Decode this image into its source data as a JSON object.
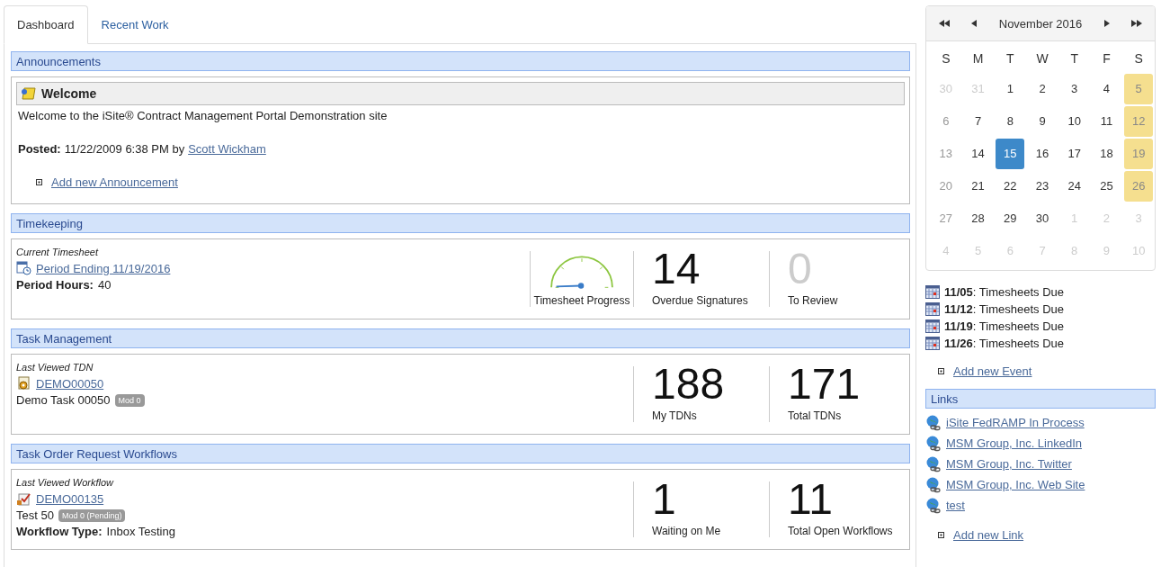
{
  "tabs": [
    {
      "label": "Dashboard",
      "selected": true
    },
    {
      "label": "Recent Work",
      "selected": false
    }
  ],
  "announcements": {
    "title": "Announcements",
    "items": [
      {
        "title": "Welcome",
        "body": "Welcome to the iSite® Contract Management Portal Demonstration site",
        "posted_label": "Posted:",
        "posted": "11/22/2009 6:38 PM by",
        "author": "Scott Wickham"
      }
    ],
    "add_link": "Add new Announcement"
  },
  "panels": [
    {
      "kind": "timesheet",
      "title": "Timekeeping",
      "caption": "Current Timesheet",
      "link": "Period Ending 11/19/2016",
      "detail_label": "Period Hours:",
      "detail": "40",
      "stats": [
        {
          "kind": "gauge",
          "label": "Timesheet Progress"
        },
        {
          "kind": "count",
          "value": "14",
          "label": "Overdue Signatures",
          "muted": false
        },
        {
          "kind": "count",
          "value": "0",
          "label": "To Review",
          "muted": true
        }
      ]
    },
    {
      "kind": "task",
      "title": "Task Management",
      "caption": "Last Viewed TDN",
      "link": "DEMO00050",
      "line": "Demo Task 00050",
      "badge": "Mod 0",
      "stats": [
        {
          "kind": "count",
          "value": "188",
          "label": "My TDNs",
          "muted": false
        },
        {
          "kind": "count",
          "value": "171",
          "label": "Total TDNs",
          "muted": false
        }
      ]
    },
    {
      "kind": "workflow",
      "title": "Task Order Request Workflows",
      "caption": "Last Viewed Workflow",
      "link": "DEMO00135",
      "line": "Test 50",
      "badge": "Mod 0 (Pending)",
      "detail_label": "Workflow Type:",
      "detail": "Inbox Testing",
      "stats": [
        {
          "kind": "count",
          "value": "1",
          "label": "Waiting on Me",
          "muted": false
        },
        {
          "kind": "count",
          "value": "11",
          "label": "Total Open Workflows",
          "muted": false
        }
      ]
    }
  ],
  "calendar": {
    "month": "November 2016",
    "weekdays": [
      "S",
      "M",
      "T",
      "W",
      "T",
      "F",
      "S"
    ],
    "days": [
      {
        "label": "30",
        "kind": "outside",
        "selected": false
      },
      {
        "label": "31",
        "kind": "outside",
        "selected": false
      },
      {
        "label": "1",
        "kind": "day",
        "selected": false
      },
      {
        "label": "2",
        "kind": "day",
        "selected": false
      },
      {
        "label": "3",
        "kind": "day",
        "selected": false
      },
      {
        "label": "4",
        "kind": "day",
        "selected": false
      },
      {
        "label": "5",
        "kind": "event",
        "selected": false
      },
      {
        "label": "6",
        "kind": "weekend",
        "selected": false
      },
      {
        "label": "7",
        "kind": "day",
        "selected": false
      },
      {
        "label": "8",
        "kind": "day",
        "selected": false
      },
      {
        "label": "9",
        "kind": "day",
        "selected": false
      },
      {
        "label": "10",
        "kind": "day",
        "selected": false
      },
      {
        "label": "11",
        "kind": "day",
        "selected": false
      },
      {
        "label": "12",
        "kind": "event",
        "selected": false
      },
      {
        "label": "13",
        "kind": "weekend",
        "selected": false
      },
      {
        "label": "14",
        "kind": "day",
        "selected": false
      },
      {
        "label": "15",
        "kind": "day",
        "selected": true
      },
      {
        "label": "16",
        "kind": "day",
        "selected": false
      },
      {
        "label": "17",
        "kind": "day",
        "selected": false
      },
      {
        "label": "18",
        "kind": "day",
        "selected": false
      },
      {
        "label": "19",
        "kind": "event",
        "selected": false
      },
      {
        "label": "20",
        "kind": "weekend",
        "selected": false
      },
      {
        "label": "21",
        "kind": "day",
        "selected": false
      },
      {
        "label": "22",
        "kind": "day",
        "selected": false
      },
      {
        "label": "23",
        "kind": "day",
        "selected": false
      },
      {
        "label": "24",
        "kind": "day",
        "selected": false
      },
      {
        "label": "25",
        "kind": "day",
        "selected": false
      },
      {
        "label": "26",
        "kind": "event",
        "selected": false
      },
      {
        "label": "27",
        "kind": "weekend",
        "selected": false
      },
      {
        "label": "28",
        "kind": "day",
        "selected": false
      },
      {
        "label": "29",
        "kind": "day",
        "selected": false
      },
      {
        "label": "30",
        "kind": "day",
        "selected": false
      },
      {
        "label": "1",
        "kind": "outside",
        "selected": false
      },
      {
        "label": "2",
        "kind": "outside",
        "selected": false
      },
      {
        "label": "3",
        "kind": "outside",
        "selected": false
      },
      {
        "label": "4",
        "kind": "outside",
        "selected": false
      },
      {
        "label": "5",
        "kind": "outside",
        "selected": false
      },
      {
        "label": "6",
        "kind": "outside",
        "selected": false
      },
      {
        "label": "7",
        "kind": "outside",
        "selected": false
      },
      {
        "label": "8",
        "kind": "outside",
        "selected": false
      },
      {
        "label": "9",
        "kind": "outside",
        "selected": false
      },
      {
        "label": "10",
        "kind": "outside",
        "selected": false
      }
    ]
  },
  "events": [
    "**11/05**: Timesheets Due",
    "**11/12**: Timesheets Due",
    "**11/19**: Timesheets Due",
    "**11/26**: Timesheets Due"
  ],
  "add_event": "Add new Event",
  "links": {
    "title": "Links",
    "items": [
      "iSite FedRAMP In Process",
      "MSM Group, Inc. LinkedIn",
      "MSM Group, Inc. Twitter",
      "MSM Group, Inc. Web Site",
      "test"
    ],
    "add_link": "Add new Link"
  }
}
